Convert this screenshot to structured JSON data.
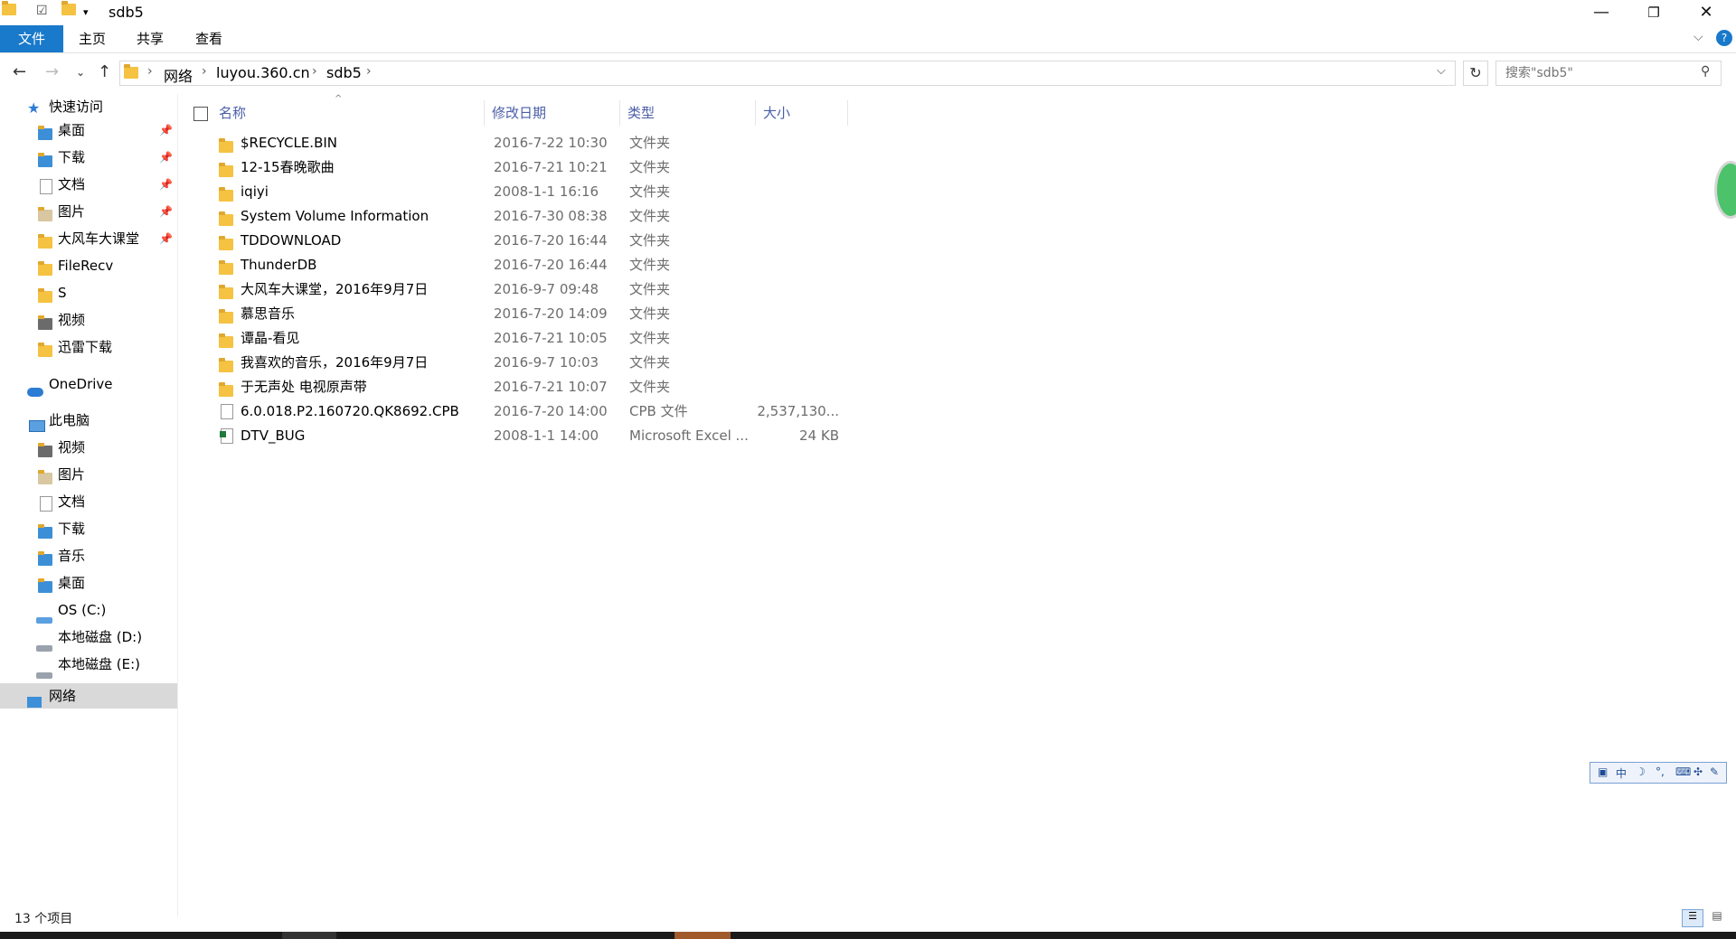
{
  "window": {
    "title": "sdb5",
    "minimize": "—",
    "maximize": "❐",
    "close": "✕"
  },
  "ribbon": {
    "tabs": [
      "文件",
      "主页",
      "共享",
      "查看"
    ],
    "help": "?"
  },
  "address": {
    "crumbs": [
      "网络",
      "luyou.360.cn",
      "sdb5"
    ],
    "search_placeholder": "搜索\"sdb5\""
  },
  "sidebar": {
    "quick_access": "快速访问",
    "quick_items": [
      {
        "label": "桌面",
        "pinned": true
      },
      {
        "label": "下载",
        "pinned": true
      },
      {
        "label": "文档",
        "pinned": true
      },
      {
        "label": "图片",
        "pinned": true
      },
      {
        "label": "大风车大课堂",
        "pinned": true
      },
      {
        "label": "FileRecv",
        "pinned": false
      },
      {
        "label": "S",
        "pinned": false
      },
      {
        "label": "视频",
        "pinned": false
      },
      {
        "label": "迅雷下载",
        "pinned": false
      }
    ],
    "onedrive": "OneDrive",
    "this_pc": "此电脑",
    "pc_items": [
      "视频",
      "图片",
      "文档",
      "下载",
      "音乐",
      "桌面",
      "OS (C:)",
      "本地磁盘 (D:)",
      "本地磁盘 (E:)"
    ],
    "network": "网络"
  },
  "columns": {
    "name": "名称",
    "date": "修改日期",
    "type": "类型",
    "size": "大小"
  },
  "files": [
    {
      "name": "$RECYCLE.BIN",
      "date": "2016-7-22 10:30",
      "type": "文件夹",
      "size": "",
      "icon": "folder-icon"
    },
    {
      "name": "12-15春晚歌曲",
      "date": "2016-7-21 10:21",
      "type": "文件夹",
      "size": "",
      "icon": "folder-icon"
    },
    {
      "name": "iqiyi",
      "date": "2008-1-1 16:16",
      "type": "文件夹",
      "size": "",
      "icon": "folder-icon"
    },
    {
      "name": "System Volume Information",
      "date": "2016-7-30 08:38",
      "type": "文件夹",
      "size": "",
      "icon": "folder-icon"
    },
    {
      "name": "TDDOWNLOAD",
      "date": "2016-7-20 16:44",
      "type": "文件夹",
      "size": "",
      "icon": "folder-icon"
    },
    {
      "name": "ThunderDB",
      "date": "2016-7-20 16:44",
      "type": "文件夹",
      "size": "",
      "icon": "folder-icon"
    },
    {
      "name": "大风车大课堂，2016年9月7日",
      "date": "2016-9-7 09:48",
      "type": "文件夹",
      "size": "",
      "icon": "folder-icon"
    },
    {
      "name": "慕思音乐",
      "date": "2016-7-20 14:09",
      "type": "文件夹",
      "size": "",
      "icon": "folder-icon"
    },
    {
      "name": "谭晶-看见",
      "date": "2016-7-21 10:05",
      "type": "文件夹",
      "size": "",
      "icon": "folder-icon"
    },
    {
      "name": "我喜欢的音乐，2016年9月7日",
      "date": "2016-9-7 10:03",
      "type": "文件夹",
      "size": "",
      "icon": "folder-icon"
    },
    {
      "name": "于无声处 电视原声带",
      "date": "2016-7-21 10:07",
      "type": "文件夹",
      "size": "",
      "icon": "folder-icon"
    },
    {
      "name": "6.0.018.P2.160720.QK8692.CPB",
      "date": "2016-7-20 14:00",
      "type": "CPB 文件",
      "size": "2,537,130...",
      "icon": "file-icon"
    },
    {
      "name": "DTV_BUG",
      "date": "2008-1-1 14:00",
      "type": "Microsoft Excel ...",
      "size": "24 KB",
      "icon": "excel-file-icon"
    }
  ],
  "status": {
    "count": "13 个项目"
  },
  "ime": {
    "text": "中"
  },
  "colors": {
    "accent": "#1979ca",
    "header_text": "#4a5ea8",
    "folder": "#f5c242"
  }
}
